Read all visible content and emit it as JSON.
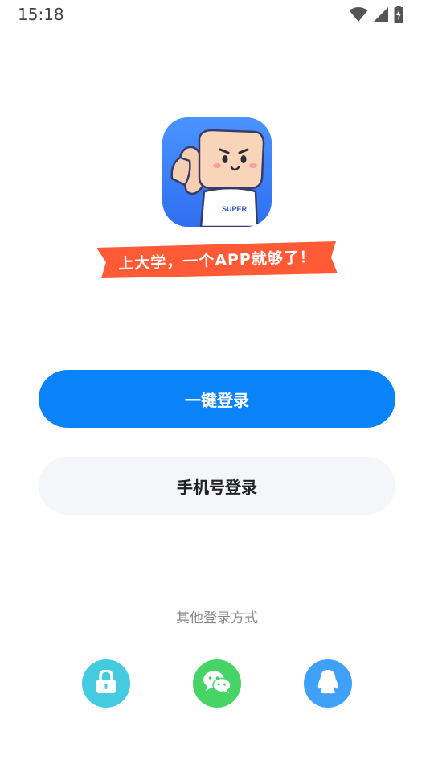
{
  "status_bar": {
    "time": "15:18",
    "icons": [
      "wifi-icon",
      "signal-icon",
      "battery-charging-icon"
    ]
  },
  "logo": {
    "shirt_text": "SUPER",
    "slogan": "上大学，一个APP就够了！"
  },
  "buttons": {
    "one_click_login": "一键登录",
    "phone_login": "手机号登录"
  },
  "other_login": {
    "title": "其他登录方式",
    "methods": [
      "lock-icon",
      "wechat-icon",
      "qq-icon"
    ]
  },
  "colors": {
    "primary": "#0a82f8",
    "secondary_bg": "#f4f6fa",
    "slogan_banner": "#ff5a36",
    "lock": "#45cbe0",
    "wechat": "#47d466",
    "qq": "#3fa0f8"
  }
}
